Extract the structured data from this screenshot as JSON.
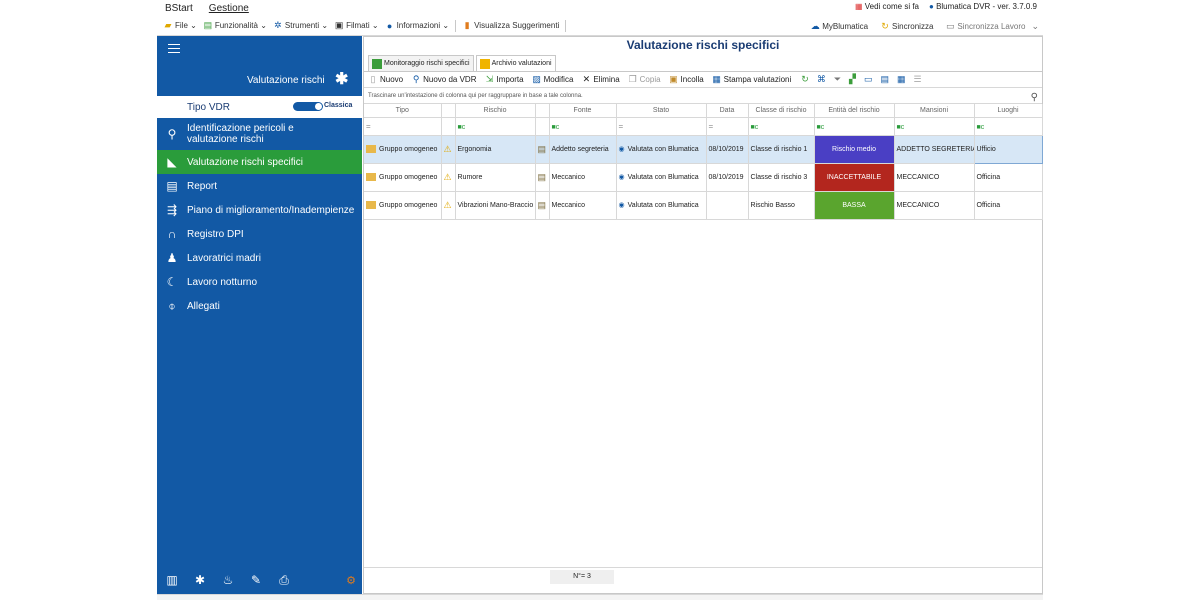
{
  "ribbon": {
    "tabs": [
      "BStart",
      "Gestione"
    ],
    "vedi_come": "Vedi come si fa",
    "version": "Blumatica DVR - ver. 3.7.0.9"
  },
  "menu": {
    "items": [
      {
        "label": "File",
        "icon": "folder-icon"
      },
      {
        "label": "Funzionalità",
        "icon": "features-icon"
      },
      {
        "label": "Strumenti",
        "icon": "tools-icon"
      },
      {
        "label": "Filmati",
        "icon": "video-icon"
      },
      {
        "label": "Informazioni",
        "icon": "info-icon"
      },
      {
        "label": "Visualizza Suggerimenti",
        "icon": "tips-icon"
      }
    ],
    "right": [
      "MyBlumatica",
      "Sincronizza",
      "Sincronizza Lavoro"
    ]
  },
  "sidebar": {
    "title": "Valutazione rischi",
    "tipo_label": "Tipo VDR",
    "toggle_label": "Classica",
    "items": [
      {
        "label": "Identificazione pericoli e valutazione rischi",
        "icon": "hazard-id-icon"
      },
      {
        "label": "Valutazione rischi specifici",
        "icon": "risk-eval-icon"
      },
      {
        "label": "Report",
        "icon": "report-icon"
      },
      {
        "label": "Piano di miglioramento/Inadempienze",
        "icon": "improvement-plan-icon"
      },
      {
        "label": "Registro DPI",
        "icon": "ppe-register-icon"
      },
      {
        "label": "Lavoratrici madri",
        "icon": "mothers-icon"
      },
      {
        "label": "Lavoro notturno",
        "icon": "night-work-icon"
      },
      {
        "label": "Allegati",
        "icon": "attachment-icon"
      }
    ]
  },
  "main": {
    "title": "Valutazione rischi specifici",
    "subtabs": [
      "Monitoraggio rischi specifici",
      "Archivio valutazioni"
    ],
    "toolbar": [
      "Nuovo",
      "Nuovo da VDR",
      "Importa",
      "Modifica",
      "Elimina",
      "Copia",
      "Incolla",
      "Stampa valutazioni"
    ],
    "group_hint": "Trascinare un'intestazione di colonna qui per raggruppare in base a tale colonna.",
    "columns": [
      "Tipo",
      "Rischio",
      "Fonte",
      "Stato",
      "Data",
      "Classe di rischio",
      "Entità del rischio",
      "Mansioni",
      "Luoghi"
    ],
    "filter_eq": "=",
    "filter_contains": "■c",
    "rows": [
      {
        "tipo": "Gruppo omogeneo",
        "rischio": "Ergonomia",
        "fonte": "Addetto segreteria",
        "stato": "Valutata con Blumatica",
        "data": "08/10/2019",
        "classe": "Classe di rischio 1",
        "entita": "Rischio medio",
        "entita_color": "#4a3fc4",
        "mansioni": "ADDETTO SEGRETERIA",
        "luoghi": "Ufficio"
      },
      {
        "tipo": "Gruppo omogeneo",
        "rischio": "Rumore",
        "fonte": "Meccanico",
        "stato": "Valutata con Blumatica",
        "data": "08/10/2019",
        "classe": "Classe di rischio 3",
        "entita": "INACCETTABILE",
        "entita_color": "#b3261e",
        "mansioni": "MECCANICO",
        "luoghi": "Officina"
      },
      {
        "tipo": "Gruppo omogeneo",
        "rischio": "Vibrazioni Mano-Braccio",
        "fonte": "Meccanico",
        "stato": "Valutata con Blumatica",
        "data": "",
        "classe": "Rischio Basso",
        "entita": "BASSA",
        "entita_color": "#5aa52e",
        "mansioni": "MECCANICO",
        "luoghi": "Officina"
      }
    ],
    "count": "N°= 3"
  }
}
